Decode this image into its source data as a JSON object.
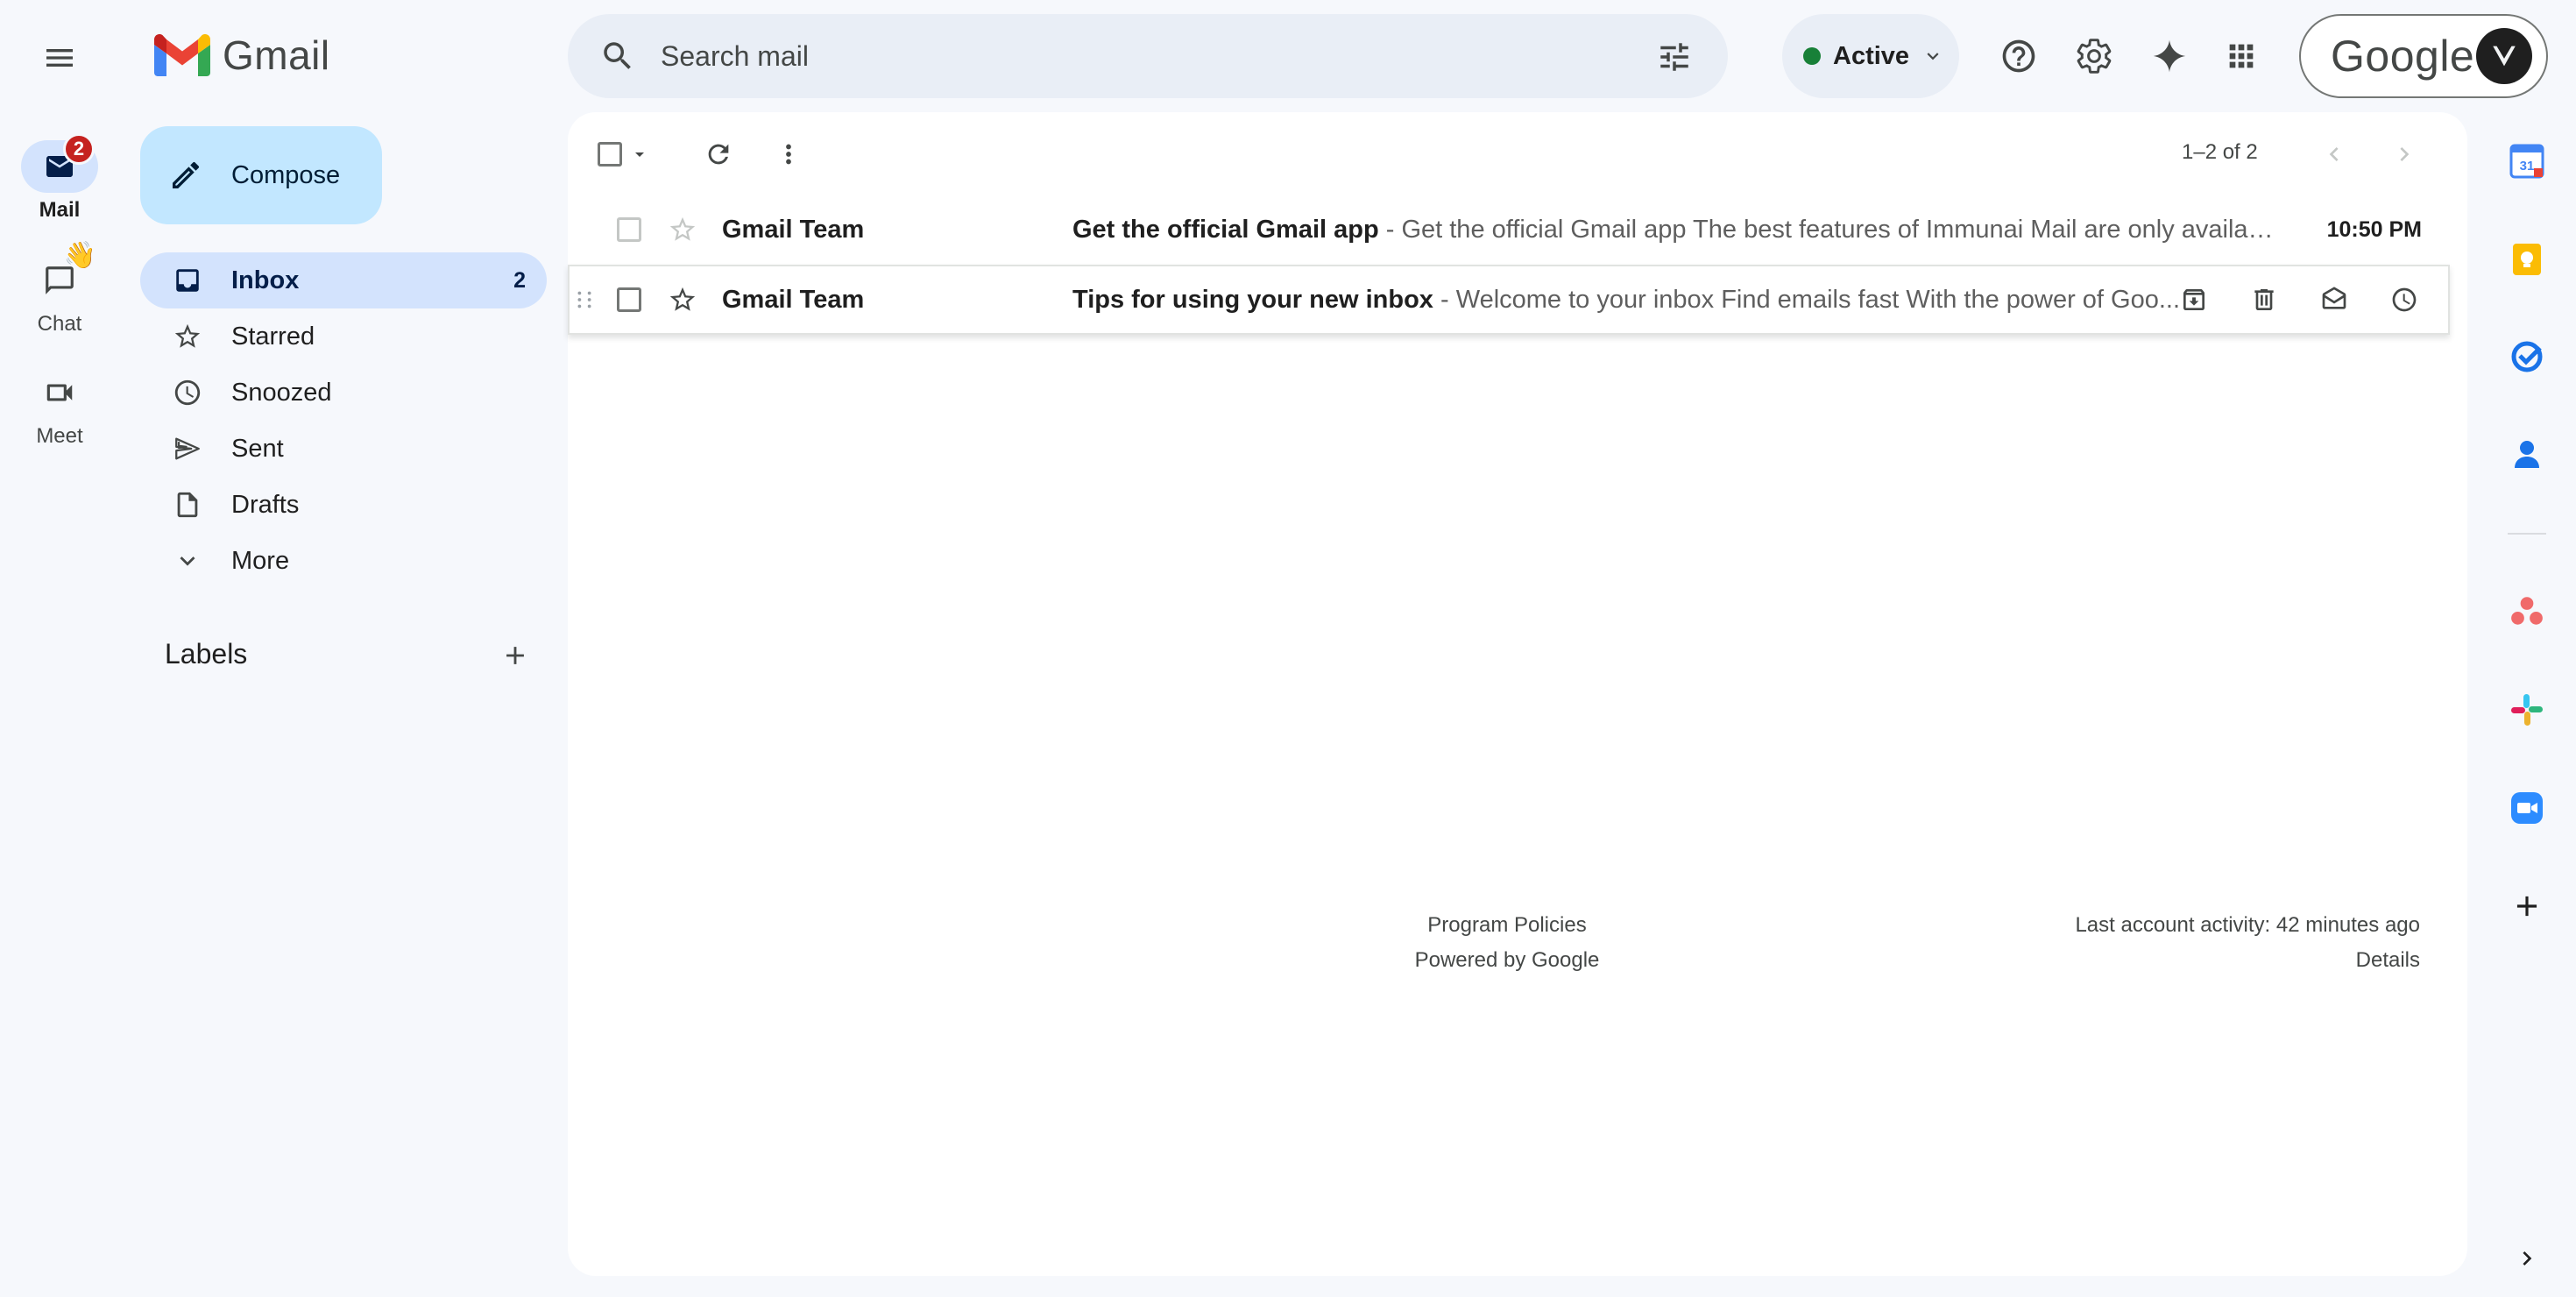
{
  "app": {
    "logo_text": "Gmail"
  },
  "rail": {
    "items": [
      {
        "label": "Mail",
        "badge": "2"
      },
      {
        "label": "Chat"
      },
      {
        "label": "Meet"
      }
    ]
  },
  "compose": {
    "label": "Compose"
  },
  "nav": {
    "items": [
      {
        "label": "Inbox",
        "count": "2",
        "icon": "inbox-icon"
      },
      {
        "label": "Starred",
        "icon": "star-icon"
      },
      {
        "label": "Snoozed",
        "icon": "clock-icon"
      },
      {
        "label": "Sent",
        "icon": "send-icon"
      },
      {
        "label": "Drafts",
        "icon": "draft-icon"
      },
      {
        "label": "More",
        "icon": "chevron-down-icon"
      }
    ]
  },
  "labels": {
    "title": "Labels"
  },
  "search": {
    "placeholder": "Search mail"
  },
  "status": {
    "label": "Active",
    "color": "#188038"
  },
  "account": {
    "word": "Google"
  },
  "toolbar": {
    "count": "1–2 of 2"
  },
  "emails": [
    {
      "sender": "Gmail Team",
      "subject": "Get the official Gmail app",
      "snippet": "Get the official Gmail app The best features of Immunai Mail are only availabl...",
      "date": "10:50 PM"
    },
    {
      "sender": "Gmail Team",
      "subject": "Tips for using your new inbox",
      "snippet": "Welcome to your inbox Find emails fast With the power of Goo..."
    }
  ],
  "footer": {
    "policies": "Program Policies",
    "powered": "Powered by Google",
    "activity": "Last account activity: 42 minutes ago",
    "details": "Details"
  },
  "colors": {
    "accent": "#0b57d0",
    "compose_bg": "#c2e7ff",
    "nav_active": "#d3e3fd",
    "badge": "#c5221f"
  }
}
